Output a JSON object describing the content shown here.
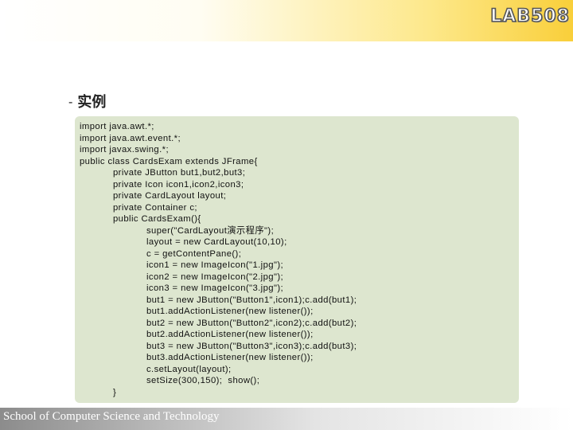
{
  "header": {
    "logo_text": "LAB508"
  },
  "slide": {
    "bullet": "-",
    "heading": "实例",
    "code_lines": [
      {
        "indent": 0,
        "text": "import java.awt.*;"
      },
      {
        "indent": 0,
        "text": "import java.awt.event.*;"
      },
      {
        "indent": 0,
        "text": "import javax.swing.*;"
      },
      {
        "indent": 0,
        "text": "public class CardsExam extends JFrame{"
      },
      {
        "indent": 1,
        "text": "private JButton but1,but2,but3;"
      },
      {
        "indent": 1,
        "text": "private Icon icon1,icon2,icon3;"
      },
      {
        "indent": 1,
        "text": "private CardLayout layout;"
      },
      {
        "indent": 1,
        "text": "private Container c;"
      },
      {
        "indent": 1,
        "text": "public CardsExam(){"
      },
      {
        "indent": 2,
        "text": "super(\"CardLayout演示程序\");"
      },
      {
        "indent": 2,
        "text": "layout = new CardLayout(10,10);"
      },
      {
        "indent": 2,
        "text": "c = getContentPane();"
      },
      {
        "indent": 2,
        "text": "icon1 = new ImageIcon(\"1.jpg\");"
      },
      {
        "indent": 2,
        "text": "icon2 = new ImageIcon(\"2.jpg\");"
      },
      {
        "indent": 2,
        "text": "icon3 = new ImageIcon(\"3.jpg\");"
      },
      {
        "indent": 2,
        "text": "but1 = new JButton(\"Button1\",icon1);c.add(but1);"
      },
      {
        "indent": 2,
        "text": "but1.addActionListener(new listener());"
      },
      {
        "indent": 2,
        "text": "but2 = new JButton(\"Button2\",icon2);c.add(but2);"
      },
      {
        "indent": 2,
        "text": "but2.addActionListener(new listener());"
      },
      {
        "indent": 2,
        "text": "but3 = new JButton(\"Button3\",icon3);c.add(but3);"
      },
      {
        "indent": 2,
        "text": "but3.addActionListener(new listener());"
      },
      {
        "indent": 2,
        "text": "c.setLayout(layout);"
      },
      {
        "indent": 2,
        "text": "setSize(300,150);  show();"
      },
      {
        "indent": 1,
        "text": "}"
      }
    ]
  },
  "footer": {
    "text": "School of Computer Science and Technology"
  }
}
